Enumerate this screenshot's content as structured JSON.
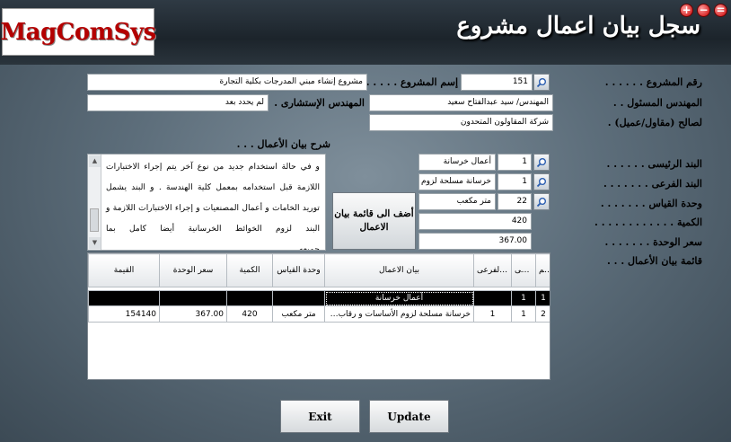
{
  "window": {
    "title": "سجل بيان اعمال مشروع",
    "logo": "MagComSys",
    "controls": [
      "−",
      "=",
      "+"
    ]
  },
  "labels": {
    "project_no": "رقم المشروع . . . . . .",
    "project_name": "إسم المشروع . . . . . .",
    "engineer": "المهندس المسئول . .",
    "consultant": "المهندس الإستشارى .",
    "for_client": "لصالح (مقاول/عميل) .",
    "work_desc": "شرح بيان الأعمال . . .",
    "main_item": "البند الرئيسى . . . . . .",
    "sub_item": "البند الفرعى . . . . . . .",
    "unit": "وحدة القياس . . . . . . .",
    "quantity": "الكمية . . . . . . . . . . . .",
    "unit_price": "سعر الوحدة . . . . . . .",
    "work_list": "قائمة بيان الأعمال . . ."
  },
  "fields": {
    "project_no": "151",
    "project_name": "مشروع إنشاء مبني المدرجات بكلية التجارة",
    "engineer": "المهندس/ سيد عبدالفتاح سعيد",
    "consultant": "لم يحدد بعد",
    "client": "شركة المقاولون المتحدون",
    "main_item_code": "1",
    "main_item_name": "أعمال خرسانة",
    "sub_item_code": "1",
    "sub_item_name": "خرسانة مسلحة لزوم الأساسات و رقاب الأعمدة",
    "unit_code": "22",
    "unit_name": "متر مكعب",
    "quantity": "420",
    "unit_price": "367.00"
  },
  "description": "و في حالة استخدام جديد من نوع آخر يتم إجراء الاختبارات اللازمة قبل استخدامه بمعمل كلية الهندسة . و البند يشمل توريد الخامات و أعمال المصنعيات و إجراء الاختبارات اللازمة و البند لزوم الخوائط الخرسانية أيضا كامل بما جميعه.................",
  "buttons": {
    "add_to_list": "أضف الى قائمة بيان الاعمال",
    "exit": "Exit",
    "update": "Update"
  },
  "grid": {
    "columns": [
      "رقم",
      "البند الرئيسى",
      "البند الفرعى",
      "بيان الاعمال",
      "وحدة القياس",
      "الكمية",
      "سعر الوحدة",
      "القيمة"
    ],
    "rows": [
      {
        "no": "1",
        "main": "1",
        "sub": "",
        "desc": "أعمال خرسانة",
        "unit": "",
        "qty": "",
        "price": "",
        "value": ""
      },
      {
        "no": "2",
        "main": "1",
        "sub": "1",
        "desc": "خرسانة مسلحة لزوم الأساسات و رقاب ا...",
        "unit": "متر مكعب",
        "qty": "420",
        "price": "367.00",
        "value": "154140"
      }
    ]
  },
  "colors": {
    "title_text": "#ffffff",
    "header_bg": "#1c242b",
    "logo_text": "#b40000",
    "selected_row": "#000000"
  }
}
